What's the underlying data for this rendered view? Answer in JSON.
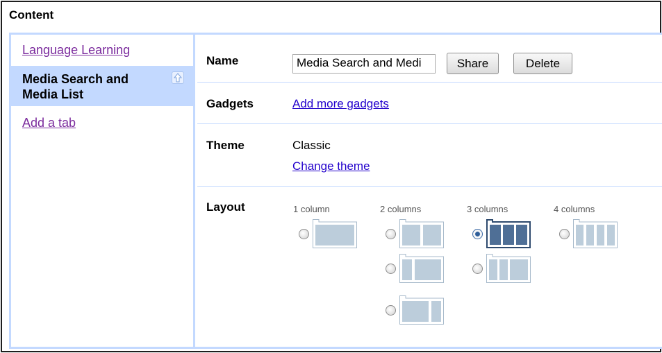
{
  "window": {
    "title": "Content"
  },
  "sidebar": {
    "items": [
      {
        "label": "Language Learning",
        "selected": false
      },
      {
        "label": "Media Search and Media List",
        "selected": true
      },
      {
        "label": "Add a tab",
        "selected": false
      }
    ]
  },
  "main": {
    "name": {
      "label": "Name",
      "value": "Media Search and Medi"
    },
    "share_label": "Share",
    "delete_label": "Delete",
    "gadgets": {
      "label": "Gadgets",
      "link": "Add more gadgets"
    },
    "theme": {
      "label": "Theme",
      "value": "Classic",
      "link": "Change theme"
    },
    "layout": {
      "label": "Layout",
      "column_headings": [
        "1 column",
        "2 columns",
        "3 columns",
        "4 columns"
      ],
      "selected": "3 columns, equal widths"
    }
  },
  "colors": {
    "panel_border": "#c3d9ff",
    "selected_tab_bg": "#c3d9ff",
    "visited_link": "#7b2b9d",
    "link": "#2200cc",
    "thumb_fill": "#bccddb",
    "thumb_selected": "#4f6f96"
  }
}
